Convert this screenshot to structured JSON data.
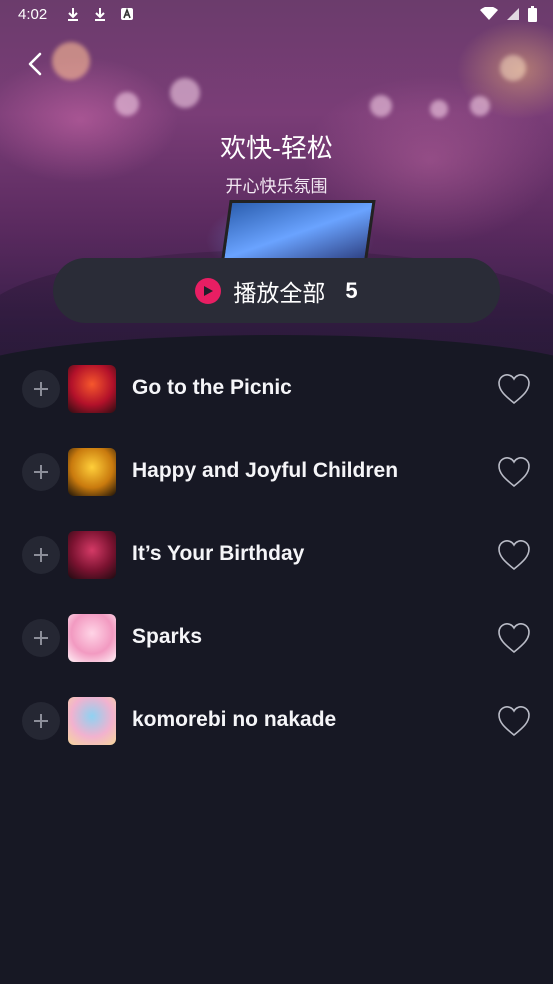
{
  "status_bar": {
    "time": "4:02",
    "icons": [
      "download-icon",
      "download-icon",
      "a-icon"
    ],
    "right_icons": [
      "wifi-icon",
      "signal-icon",
      "battery-icon"
    ]
  },
  "header": {
    "title": "欢快-轻松",
    "subtitle": "开心快乐氛围"
  },
  "play_all": {
    "label": "播放全部",
    "count": "5",
    "accent": "#e81e63"
  },
  "songs": [
    {
      "title": "Go to the Picnic",
      "thumb_colors": [
        "#f6572c",
        "#b3112a",
        "#2a0d12"
      ]
    },
    {
      "title": "Happy and Joyful Children",
      "thumb_colors": [
        "#ffcf3a",
        "#c97a0e",
        "#1b1208"
      ]
    },
    {
      "title": "It’s Your Birthday",
      "thumb_colors": [
        "#d43a66",
        "#7a1230",
        "#1e0b10"
      ]
    },
    {
      "title": "Sparks",
      "thumb_colors": [
        "#ffd4e6",
        "#f29ac1",
        "#fff1f6"
      ]
    },
    {
      "title": "komorebi no nakade",
      "thumb_colors": [
        "#8fd2f2",
        "#f2b2cf",
        "#f6d69a"
      ]
    }
  ]
}
